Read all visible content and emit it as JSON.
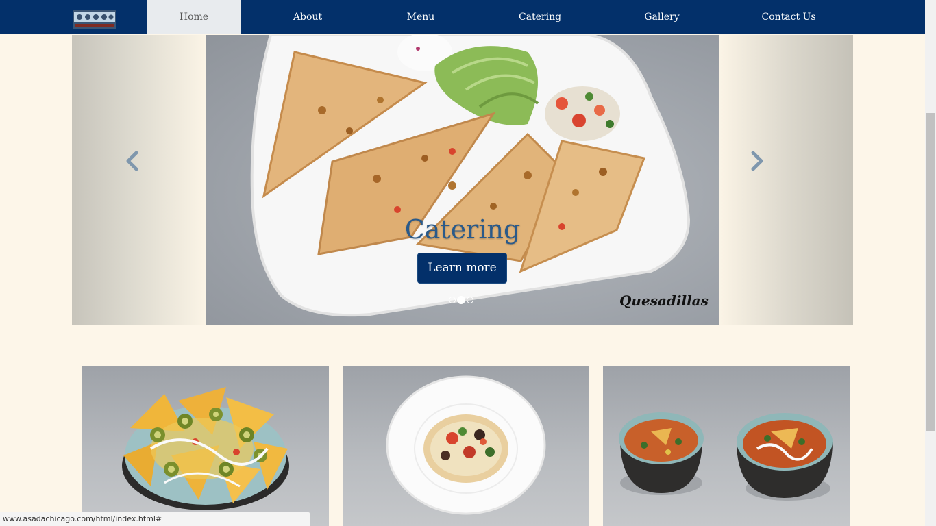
{
  "brand": {
    "logo_icon": "asada-logo-icon"
  },
  "nav": {
    "items": [
      {
        "label": "Home",
        "active": true
      },
      {
        "label": "About",
        "active": false
      },
      {
        "label": "Menu",
        "active": false
      },
      {
        "label": "Catering",
        "active": false
      },
      {
        "label": "Gallery",
        "active": false
      },
      {
        "label": "Contact Us",
        "active": false
      }
    ]
  },
  "carousel": {
    "caption_title": "Catering",
    "button_label": "Learn more",
    "slide_label": "Quesadillas",
    "indicator_count": 3,
    "active_indicator": 2,
    "prev_icon": "chevron-left-icon",
    "next_icon": "chevron-right-icon"
  },
  "status_bar": {
    "url": "www.asadachicago.com/html/index.html#"
  },
  "colors": {
    "nav_bg": "#03306a",
    "page_bg": "#fdf6e9",
    "accent": "#2a5a8a",
    "button_bg": "#03306a"
  }
}
